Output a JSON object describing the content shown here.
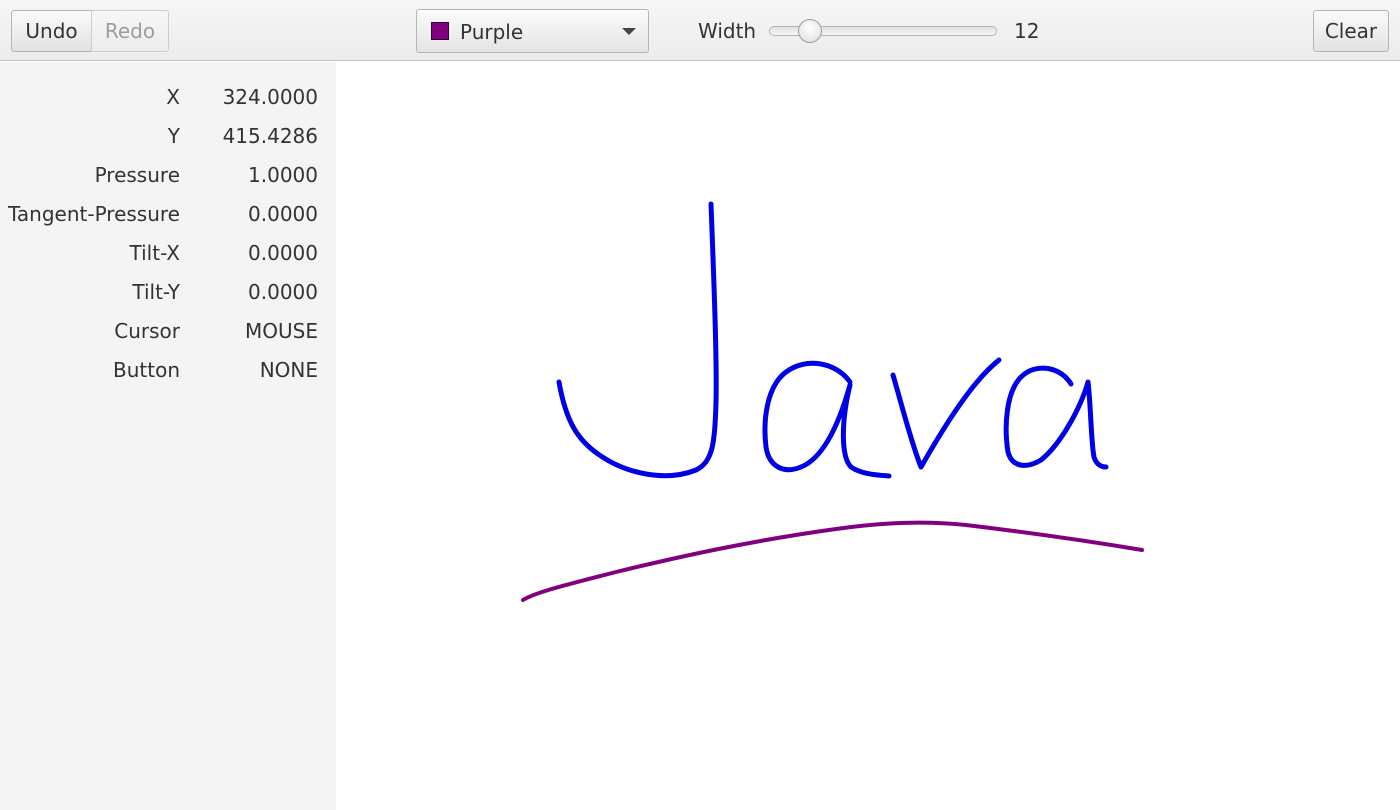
{
  "toolbar": {
    "undo_label": "Undo",
    "redo_label": "Redo",
    "color_select": {
      "selected": "Purple",
      "swatch_color": "#800080"
    },
    "width_label": "Width",
    "width_value": "12",
    "width_slider_fraction": 0.14,
    "clear_label": "Clear"
  },
  "properties": [
    {
      "name": "X",
      "value": "324.0000"
    },
    {
      "name": "Y",
      "value": "415.4286"
    },
    {
      "name": "Pressure",
      "value": "1.0000"
    },
    {
      "name": "Tangent-Pressure",
      "value": "0.0000"
    },
    {
      "name": "Tilt-X",
      "value": "0.0000"
    },
    {
      "name": "Tilt-Y",
      "value": "0.0000"
    },
    {
      "name": "Cursor",
      "value": "MOUSE"
    },
    {
      "name": "Button",
      "value": "NONE"
    }
  ],
  "canvas": {
    "strokes": [
      {
        "id": "J",
        "color": "#0000e6"
      },
      {
        "id": "a1",
        "color": "#0000e6"
      },
      {
        "id": "v",
        "color": "#0000e6"
      },
      {
        "id": "a2",
        "color": "#0000e6"
      },
      {
        "id": "underline",
        "color": "#800080"
      }
    ]
  }
}
